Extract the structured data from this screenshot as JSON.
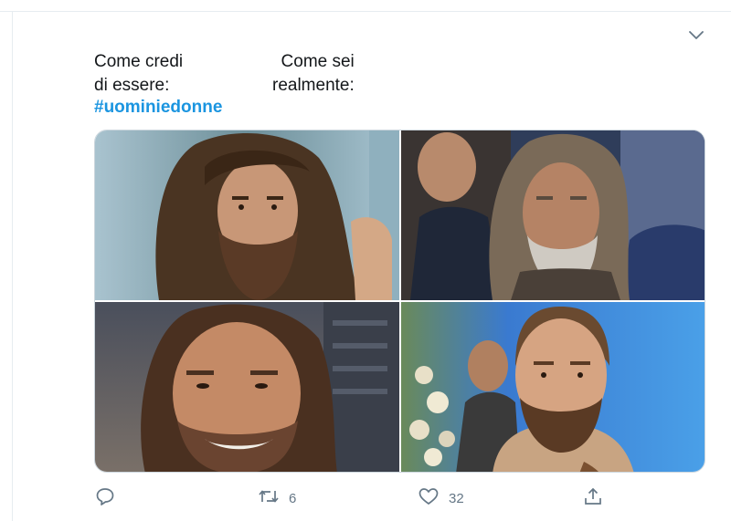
{
  "tweet": {
    "caption_left_line1": "Come credi",
    "caption_left_line2": "di essere:",
    "caption_right_line1": "Come sei",
    "caption_right_line2": "realmente:",
    "hashtag": "#uominiedonne"
  },
  "media": {
    "photos": [
      "photo-top-left",
      "photo-top-right",
      "photo-bottom-left",
      "photo-bottom-right"
    ]
  },
  "actions": {
    "reply_icon": "reply-icon",
    "retweet_icon": "retweet-icon",
    "retweet_count": "6",
    "like_icon": "heart-icon",
    "like_count": "32",
    "share_icon": "share-icon"
  },
  "colors": {
    "accent": "#1b95e0",
    "muted": "#657786",
    "border": "#e6ecf0"
  }
}
